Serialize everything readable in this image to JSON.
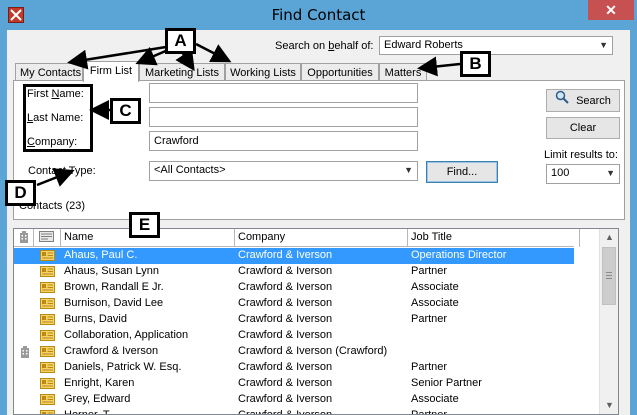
{
  "window": {
    "title": "Find Contact",
    "close_label": "✕"
  },
  "behalf": {
    "label_pre": "Search on ",
    "label_u": "b",
    "label_post": "ehalf of:",
    "value": "Edward Roberts"
  },
  "tabs": [
    {
      "label": "My Contacts"
    },
    {
      "label": "Firm List"
    },
    {
      "label": "Marketing Lists"
    },
    {
      "label": "Working Lists"
    },
    {
      "label": "Opportunities"
    },
    {
      "label": "Matters"
    }
  ],
  "form": {
    "first_pre": "First ",
    "first_u": "N",
    "first_post": "ame:",
    "first_value": "",
    "last_pre": "",
    "last_u": "L",
    "last_post": "ast Name:",
    "last_value": "",
    "company_pre": "",
    "company_u": "C",
    "company_post": "ompany:",
    "company_value": "Crawford",
    "type_label": "Contact Type:",
    "type_value": "<All Contacts>",
    "find_label": "Find..."
  },
  "actions": {
    "search_label": "Search",
    "clear_label": "Clear",
    "limit_label": "Limit results to:",
    "limit_value": "100"
  },
  "results": {
    "count_label": "Contacts (23)",
    "columns": [
      "Name",
      "Company",
      "Job Title"
    ],
    "rows": [
      {
        "name": "Ahaus, Paul C.",
        "company": "Crawford & Iverson",
        "title": "Operations Director",
        "selected": true
      },
      {
        "name": "Ahaus, Susan Lynn",
        "company": "Crawford & Iverson",
        "title": "Partner"
      },
      {
        "name": "Brown, Randall E Jr.",
        "company": "Crawford & Iverson",
        "title": "Associate"
      },
      {
        "name": "Burnison, David Lee",
        "company": "Crawford & Iverson",
        "title": "Associate"
      },
      {
        "name": "Burns, David",
        "company": "Crawford & Iverson",
        "title": "Partner"
      },
      {
        "name": "Collaboration, Application",
        "company": "Crawford & Iverson",
        "title": ""
      },
      {
        "name": "Crawford & Iverson",
        "company": "Crawford & Iverson (Crawford)",
        "title": "",
        "firm": true
      },
      {
        "name": "Daniels, Patrick W. Esq.",
        "company": "Crawford & Iverson",
        "title": "Partner"
      },
      {
        "name": "Enright, Karen",
        "company": "Crawford & Iverson",
        "title": "Senior Partner"
      },
      {
        "name": "Grey, Edward",
        "company": "Crawford & Iverson",
        "title": "Associate"
      },
      {
        "name": "Horner, T...",
        "company": "Crawford & Iverson",
        "title": "Partner"
      }
    ]
  },
  "callouts": {
    "a": "A",
    "b": "B",
    "c": "C",
    "d": "D",
    "e": "E"
  },
  "colors": {
    "titlebar": "#5aa5d6",
    "selection": "#3399ff",
    "close": "#c75050"
  }
}
